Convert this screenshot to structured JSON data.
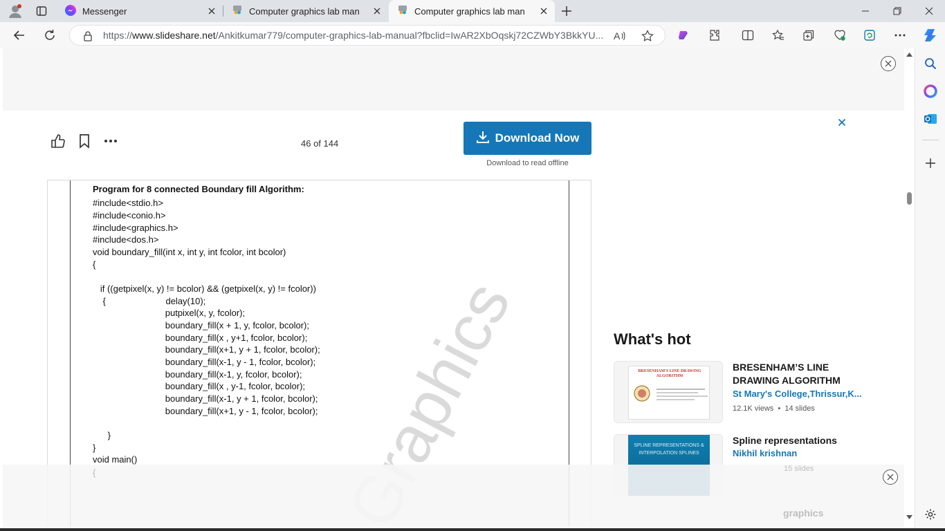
{
  "browser": {
    "tabs": [
      {
        "title": "Messenger",
        "active": false
      },
      {
        "title": "Computer graphics lab manual |",
        "active": false
      },
      {
        "title": "Computer graphics lab manual |",
        "active": true
      }
    ],
    "url_prefix": "https://",
    "url_host": "www.slideshare.net",
    "url_path": "/Ankitkumar779/computer-graphics-lab-manual?fbclid=IwAR2XbOqskj72CZWbY3BkkYU...",
    "accent_color": "#1577b8"
  },
  "viewer": {
    "page_counter": "46 of 144",
    "download_label": "Download Now",
    "download_sub": "Download to read offline"
  },
  "document": {
    "heading": "Program for 8 connected Boundary fill Algorithm:",
    "lines": [
      "#include<stdio.h>",
      "#include<conio.h>",
      "#include<graphics.h>",
      "#include<dos.h>",
      "void boundary_fill(int x, int y, int fcolor, int bcolor)",
      "{",
      "",
      "   if ((getpixel(x, y) != bcolor) && (getpixel(x, y) != fcolor))",
      "    {                        delay(10);",
      "                             putpixel(x, y, fcolor);",
      "                             boundary_fill(x + 1, y, fcolor, bcolor);",
      "                             boundary_fill(x , y+1, fcolor, bcolor);",
      "                             boundary_fill(x+1, y + 1, fcolor, bcolor);",
      "                             boundary_fill(x-1, y - 1, fcolor, bcolor);",
      "                             boundary_fill(x-1, y, fcolor, bcolor);",
      "                             boundary_fill(x , y-1, fcolor, bcolor);",
      "                             boundary_fill(x-1, y + 1, fcolor, bcolor);",
      "                             boundary_fill(x+1, y - 1, fcolor, bcolor);",
      "",
      "      }",
      "}",
      "void main()",
      "{"
    ],
    "watermark": "Graphics"
  },
  "whats_hot": {
    "heading": "What's hot",
    "items": [
      {
        "title": "BRESENHAM’S  LINE DRAWING ALGORITHM",
        "author": "St Mary's College,Thrissur,K...",
        "views": "12.1K views",
        "slides": "14 slides",
        "thumb_title": "BRESENHAM'S LINE DRAWING ALGORITHM"
      },
      {
        "title": "Spline representations",
        "author": "Nikhil krishnan",
        "slides": "15 slides",
        "thumb_title": "SPLINE REPRESENTATIONS & INTERPOLATION SPLINES"
      }
    ]
  },
  "bottom_ghost": {
    "text": "graphics"
  }
}
